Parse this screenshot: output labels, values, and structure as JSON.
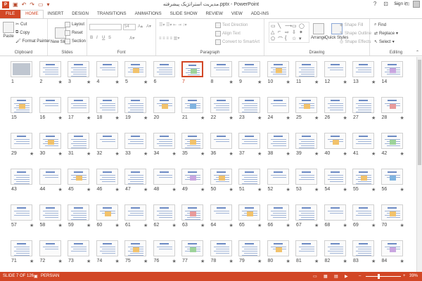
{
  "titlebar": {
    "title": "مدیریت استراتژیک پیشرفته.pptx - PowerPoint",
    "app_icon": "P",
    "save_icon": "save-icon",
    "undo_icon": "undo-icon",
    "redo_icon": "redo-icon",
    "help": "?",
    "minimize": "–",
    "maximize": "□",
    "close": "✕"
  },
  "tabs": [
    "FILE",
    "HOME",
    "INSERT",
    "DESIGN",
    "TRANSITIONS",
    "ANIMATIONS",
    "SLIDE SHOW",
    "REVIEW",
    "VIEW",
    "ADD-INS"
  ],
  "active_tab": "HOME",
  "signin": "Sign in",
  "ribbon": {
    "clipboard": {
      "label": "Clipboard",
      "paste": "Paste",
      "cut": "Cut",
      "copy": "Copy",
      "format_painter": "Format Painter"
    },
    "slides": {
      "label": "Slides",
      "new_slide": "New Slide",
      "layout": "Layout",
      "reset": "Reset",
      "section": "Section"
    },
    "font": {
      "label": "Font",
      "size": "54"
    },
    "paragraph": {
      "label": "Paragraph",
      "text_direction": "Text Direction",
      "align_text": "Align Text",
      "smartart": "Convert to SmartArt"
    },
    "drawing": {
      "label": "Drawing",
      "arrange": "Arrange",
      "quick_styles": "Quick Styles",
      "shape_fill": "Shape Fill",
      "shape_outline": "Shape Outline",
      "shape_effects": "Shape Effects"
    },
    "editing": {
      "label": "Editing",
      "find": "Find",
      "replace": "Replace",
      "select": "Select"
    }
  },
  "slides": {
    "total": 84,
    "selected": 7,
    "starred": [
      2,
      3,
      4,
      5,
      8,
      9,
      10,
      11,
      12,
      13,
      16,
      17,
      18,
      19,
      21,
      22,
      23,
      24,
      25,
      26,
      27,
      28,
      29,
      30,
      31,
      32,
      33,
      34,
      35,
      36,
      37,
      38,
      39,
      40,
      41,
      42,
      44,
      45,
      46,
      47,
      48,
      49,
      50,
      51,
      52,
      53,
      54,
      55,
      56,
      57,
      58,
      59,
      60,
      61,
      62,
      63,
      64,
      65,
      66,
      67,
      68,
      69,
      70,
      71,
      72,
      73,
      74,
      75,
      76,
      77,
      78,
      79,
      80,
      81,
      82,
      83,
      84
    ]
  },
  "status": {
    "slide_info": "SLIDE 7 OF 126",
    "language": "PERSIAN",
    "zoom": "39%"
  }
}
